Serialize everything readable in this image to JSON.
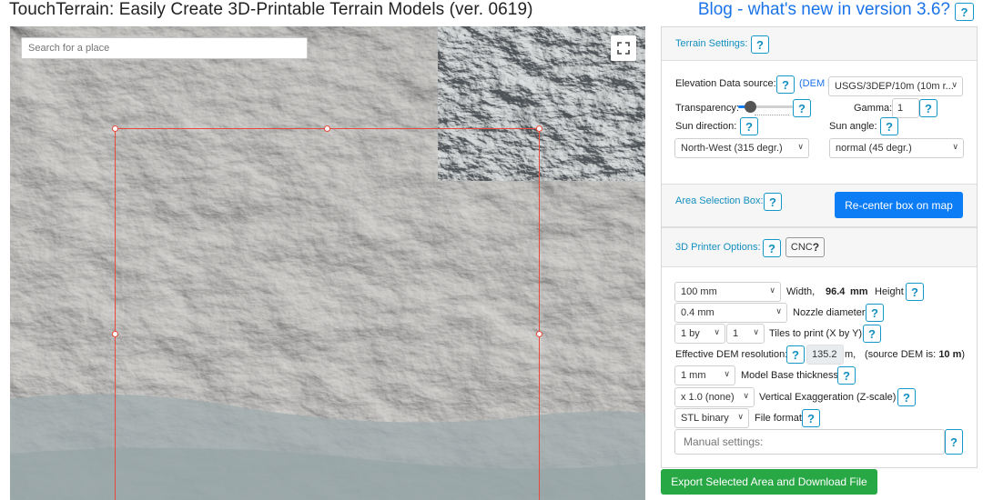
{
  "header": {
    "title": "TouchTerrain: Easily Create 3D-Printable Terrain Models (ver. 0619)",
    "blog_link": "Blog - what's new in version 3.6?",
    "help": "?"
  },
  "map": {
    "search_placeholder": "Search for a place",
    "fullscreen_icon": "fullscreen-icon"
  },
  "terrain_settings": {
    "header": "Terrain Settings:",
    "elevation_label": "Elevation Data source:",
    "dem_link": "(DEM li",
    "elevation_value": "USGS/3DEP/10m (10m r...",
    "transparency_label": "Transparency:",
    "transparency_level_percent": 15,
    "gamma_label": "Gamma:",
    "gamma_value": "1",
    "sun_direction_label": "Sun direction:",
    "sun_direction_value": "North-West (315 degr.)",
    "sun_angle_label": "Sun angle:",
    "sun_angle_value": "normal (45 degr.)"
  },
  "area_selection": {
    "header": "Area Selection Box:",
    "recenter_button": "Re-center box on map"
  },
  "printer_options": {
    "header": "3D Printer Options:",
    "cnc_button": "CNC",
    "width_value": "100 mm",
    "width_label": "Width,",
    "height_value": "96.4",
    "height_unit": "mm",
    "height_label": "Height",
    "nozzle_value": "0.4 mm",
    "nozzle_label": "Nozzle diameter",
    "tiles_x": "1 by",
    "tiles_y": "1",
    "tiles_label": "Tiles to print (X by Y)",
    "dem_res_label": "Effective DEM resolution:",
    "dem_res_value": "135.2",
    "dem_res_unit": "m,",
    "source_dem_prefix": "(source DEM is:",
    "source_dem_value": "10 m",
    "source_dem_suffix": ")",
    "base_value": "1 mm",
    "base_label": "Model Base thickness",
    "vert_exag_value": "x 1.0 (none)",
    "vert_exag_label": "Vertical Exaggeration (Z-scale)",
    "file_format_value": "STL binary",
    "file_format_label": "File format",
    "manual_placeholder": "Manual settings:"
  },
  "export_button": "Export Selected Area and Download File"
}
